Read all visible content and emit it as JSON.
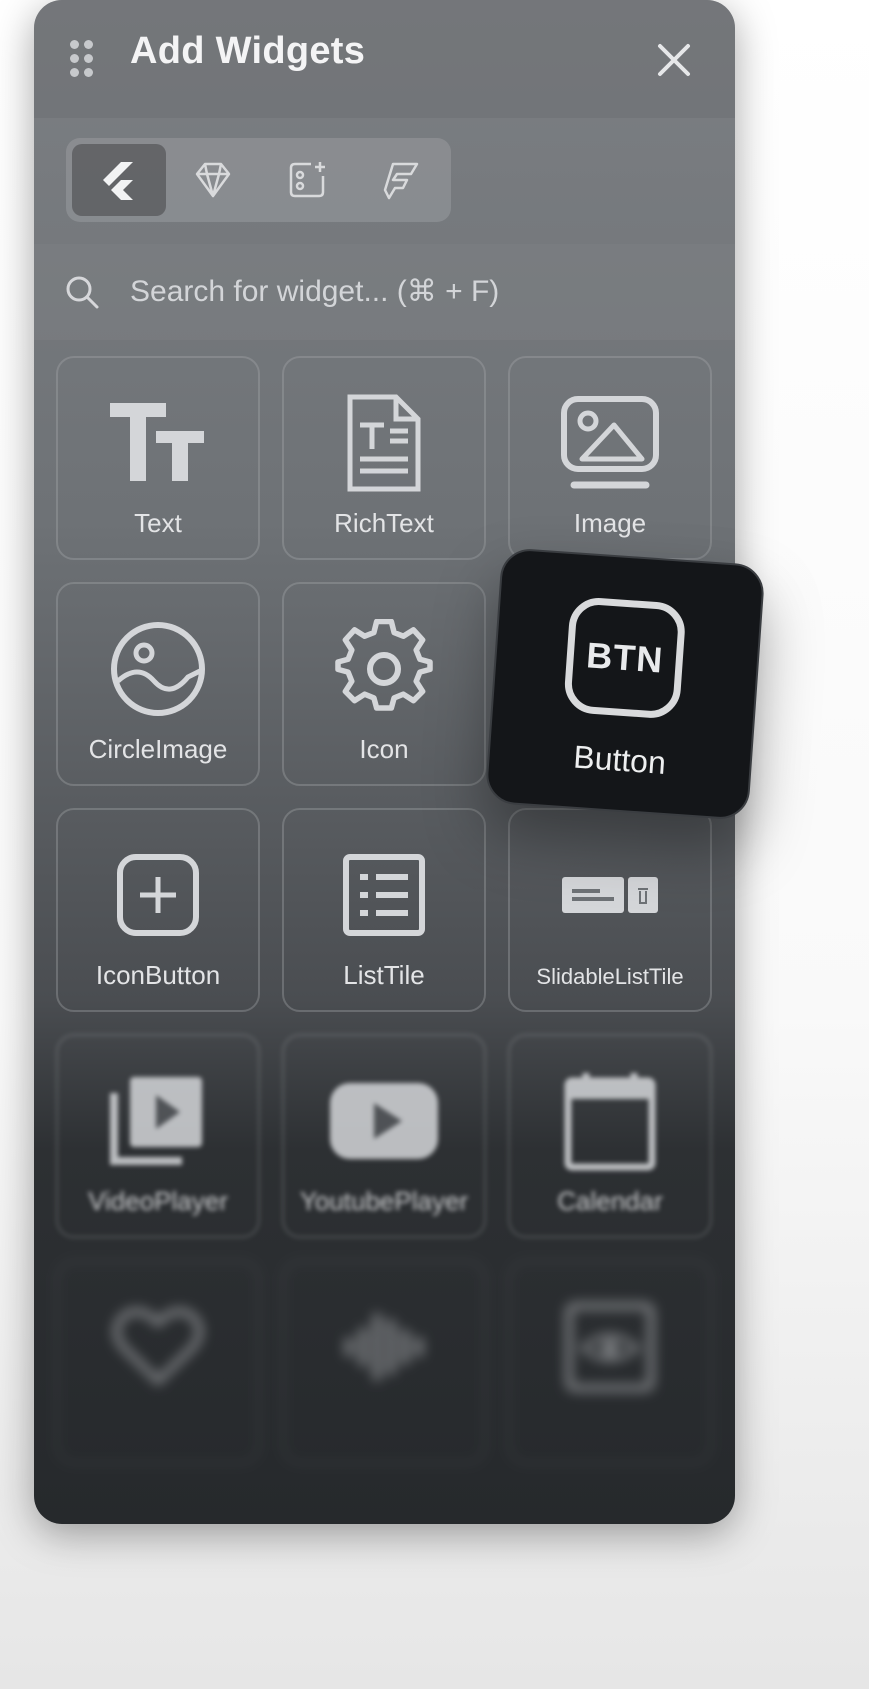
{
  "panel": {
    "title": "Add Widgets",
    "tabs": [
      "flutter-icon",
      "diamond-icon",
      "custom-widget-icon",
      "flutterflow-icon"
    ],
    "search_placeholder": "Search for widget... (⌘ + F)"
  },
  "widgets": [
    {
      "label": "Text",
      "icon": "text-icon"
    },
    {
      "label": "RichText",
      "icon": "rich-text-icon"
    },
    {
      "label": "Image",
      "icon": "image-icon"
    },
    {
      "label": "CircleImage",
      "icon": "circle-image-icon"
    },
    {
      "label": "Icon",
      "icon": "gear-icon"
    },
    {
      "label": "IconButton",
      "icon": "add-box-icon"
    },
    {
      "label": "ListTile",
      "icon": "list-icon"
    },
    {
      "label": "SlidableListTile",
      "icon": "slidable-icon"
    },
    {
      "label": "VideoPlayer",
      "icon": "video-library-icon"
    },
    {
      "label": "YoutubePlayer",
      "icon": "youtube-icon"
    },
    {
      "label": "Calendar",
      "icon": "calendar-icon"
    }
  ],
  "dragging": {
    "label": "Button",
    "icon_text": "BTN"
  },
  "colors": {
    "panel": "#6e7276",
    "floating_card": "#141619",
    "icon": "#d4d6d9"
  }
}
